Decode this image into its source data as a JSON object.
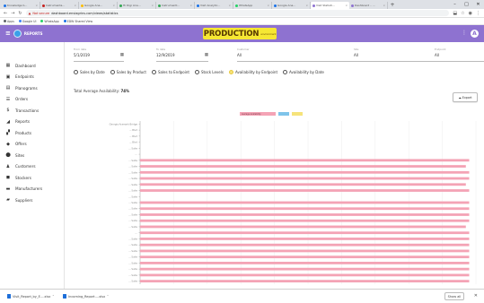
{
  "browser": {
    "tabs": [
      {
        "label": "Knowledge b…",
        "color": "#1a73e8",
        "active": false
      },
      {
        "label": "Instrumenta…",
        "color": "#c5221f",
        "active": false
      },
      {
        "label": "Google Ana…",
        "color": "#fbbc04",
        "active": false
      },
      {
        "label": "Hi Digi Ana…",
        "color": "#34a853",
        "active": false
      },
      {
        "label": "Instrumentl…",
        "color": "#34a853",
        "active": false
      },
      {
        "label": "Visit Analytic…",
        "color": "#1a73e8",
        "active": false
      },
      {
        "label": "WhatsApp",
        "color": "#25d366",
        "active": false
      },
      {
        "label": "Google Ana…",
        "color": "#1a73e8",
        "active": false
      },
      {
        "label": "Visit Statisti…",
        "color": "#8e72d0",
        "active": true
      },
      {
        "label": "Dashboard – …",
        "color": "#8e72d0",
        "active": false
      }
    ],
    "new_tab": "+",
    "window_controls": [
      "–",
      "□",
      "✕"
    ],
    "not_secure": "Not secure",
    "url": "dashboard.enviagrins.com/views/statistics",
    "bookmarks": [
      {
        "label": "Apps",
        "color": "#5f6368"
      },
      {
        "label": "Google UI",
        "color": "#4285f4"
      },
      {
        "label": "WhatsApp",
        "color": "#25d366"
      },
      {
        "label": "EDW Shared View",
        "color": "#1a73e8"
      }
    ]
  },
  "header": {
    "brand": "REPORTS",
    "env_label": "PRODUCTION",
    "env_sub": "environment",
    "user_initial": "A"
  },
  "sidebar": {
    "items": [
      {
        "label": "Dashboard",
        "icon": "dashboard-icon",
        "glyph": "▦"
      },
      {
        "label": "Endpoints",
        "icon": "endpoints-icon",
        "glyph": "▣"
      },
      {
        "label": "Planograms",
        "icon": "planogram-icon",
        "glyph": "▤"
      },
      {
        "label": "Orders",
        "icon": "orders-icon",
        "glyph": "☰"
      },
      {
        "label": "Transactions",
        "icon": "transactions-icon",
        "glyph": "$"
      },
      {
        "label": "Reports",
        "icon": "reports-icon",
        "glyph": "◢"
      },
      {
        "label": "Products",
        "icon": "products-icon",
        "glyph": "▞"
      },
      {
        "label": "Offers",
        "icon": "offers-icon",
        "glyph": "◆"
      },
      {
        "label": "Sites",
        "icon": "sites-icon",
        "glyph": "⬤"
      },
      {
        "label": "Customers",
        "icon": "customers-icon",
        "glyph": "♟"
      },
      {
        "label": "Stockers",
        "icon": "stockers-icon",
        "glyph": "◼"
      },
      {
        "label": "Manufacturers",
        "icon": "manufacturers-icon",
        "glyph": "▬"
      },
      {
        "label": "Suppliers",
        "icon": "suppliers-icon",
        "glyph": "▰"
      }
    ]
  },
  "filters": [
    {
      "label": "From date",
      "value": "5/1/2019",
      "has_calendar": true
    },
    {
      "label": "To date",
      "value": "12/9/2019",
      "has_calendar": true
    },
    {
      "label": "Customer",
      "value": "All",
      "has_calendar": false
    },
    {
      "label": "Site",
      "value": "All",
      "has_calendar": false
    },
    {
      "label": "Endpoint",
      "value": "All",
      "has_calendar": false
    }
  ],
  "report_types": [
    {
      "label": "Sales by Date",
      "checked": false
    },
    {
      "label": "Sales by Product",
      "checked": false
    },
    {
      "label": "Sales to Endpoint",
      "checked": false
    },
    {
      "label": "Stock Levels",
      "checked": false
    },
    {
      "label": "Availability by Endpoint",
      "checked": true
    },
    {
      "label": "Availability by Date",
      "checked": false
    }
  ],
  "summary": {
    "label": "Total Average Availability",
    "value": "74%"
  },
  "export_label": "Export",
  "colors": {
    "accent": "#8e72d0",
    "production_badge": "#f6e733",
    "bar_pink": "#f4a3b5",
    "bar_blue": "#7fc4ea",
    "bar_yellow": "#f6e37a"
  },
  "chart_data": {
    "type": "bar",
    "orientation": "horizontal",
    "title": "",
    "legend_position": "top",
    "series": [
      {
        "name": "Average Availability",
        "color": "#f4a3b5"
      },
      {
        "name": "",
        "color": "#7fc4ea"
      },
      {
        "name": "",
        "color": "#f6e37a"
      }
    ],
    "categories": [
      "Georgia Aramark Bridge",
      "… Blvd",
      "… Blvd",
      "… Blvd",
      "… Suite",
      "…",
      "… Suite",
      "… Suite",
      "… Suite",
      "… Suite",
      "… Suite",
      "… Suite",
      "… Suite",
      "… Suite",
      "… Suite",
      "… Suite",
      "… Suite",
      "… Suite",
      "…",
      "… Suite",
      "… Suite",
      "… Suite",
      "… Suite",
      "… Suite",
      "… Suite",
      "… Suite",
      "… Suite"
    ],
    "values": [
      0,
      0,
      0,
      0,
      0,
      0,
      98,
      97,
      98,
      98,
      97,
      98,
      0,
      98,
      98,
      98,
      98,
      97,
      98,
      98,
      98,
      98,
      98,
      98,
      98,
      98,
      98
    ],
    "xlim": [
      0,
      100
    ],
    "grid": true
  },
  "downloads": [
    {
      "label": "Visit_Report_by_E….xlsx"
    },
    {
      "label": "Incoming_Report….xlsx"
    }
  ],
  "show_all_label": "Show all"
}
